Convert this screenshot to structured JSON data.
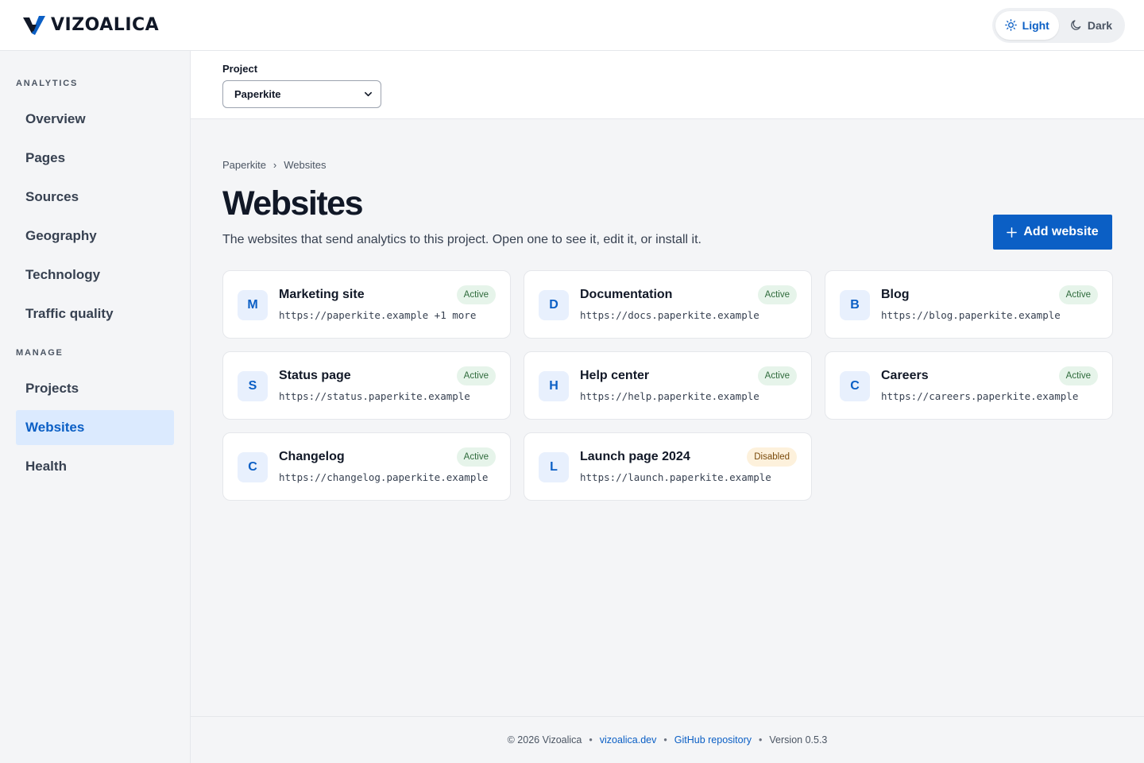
{
  "brand": {
    "name": "VIZOALICA",
    "logo_icon": "vizoalica-logo-icon"
  },
  "theme": {
    "light_label": "Light",
    "dark_label": "Dark",
    "selected": "Light"
  },
  "sidebar": {
    "groups": [
      {
        "label": "ANALYTICS",
        "items": [
          {
            "label": "Overview"
          },
          {
            "label": "Pages"
          },
          {
            "label": "Sources"
          },
          {
            "label": "Geography"
          },
          {
            "label": "Technology"
          },
          {
            "label": "Traffic quality"
          }
        ]
      },
      {
        "label": "MANAGE",
        "items": [
          {
            "label": "Projects"
          },
          {
            "label": "Websites",
            "active": true
          },
          {
            "label": "Health"
          }
        ]
      }
    ]
  },
  "project": {
    "label": "Project",
    "selected": "Paperkite"
  },
  "breadcrumb": {
    "items": [
      "Paperkite",
      "Websites"
    ],
    "separator": "›"
  },
  "page": {
    "title": "Websites",
    "subtitle": "The websites that send analytics to this project. Open one to see it, edit it, or install it.",
    "add_button_label": "Add website"
  },
  "websites": [
    {
      "initial": "M",
      "name": "Marketing site",
      "url": "https://paperkite.example +1 more",
      "status": "Active"
    },
    {
      "initial": "D",
      "name": "Documentation",
      "url": "https://docs.paperkite.example",
      "status": "Active"
    },
    {
      "initial": "B",
      "name": "Blog",
      "url": "https://blog.paperkite.example",
      "status": "Active"
    },
    {
      "initial": "S",
      "name": "Status page",
      "url": "https://status.paperkite.example",
      "status": "Active"
    },
    {
      "initial": "H",
      "name": "Help center",
      "url": "https://help.paperkite.example",
      "status": "Active"
    },
    {
      "initial": "C",
      "name": "Careers",
      "url": "https://careers.paperkite.example",
      "status": "Active"
    },
    {
      "initial": "C",
      "name": "Changelog",
      "url": "https://changelog.paperkite.example",
      "status": "Active"
    },
    {
      "initial": "L",
      "name": "Launch page 2024",
      "url": "https://launch.paperkite.example",
      "status": "Disabled"
    }
  ],
  "footer": {
    "copyright": "© 2026 Vizoalica",
    "site_link": "vizoalica.dev",
    "repo_link": "GitHub repository",
    "version": "Version 0.5.3",
    "separator": "•"
  },
  "colors": {
    "accent": "#0b5fc5",
    "active_nav_bg": "#dbeafe",
    "status_active_bg": "#e6f4ea",
    "status_disabled_bg": "#fdf1dc"
  }
}
